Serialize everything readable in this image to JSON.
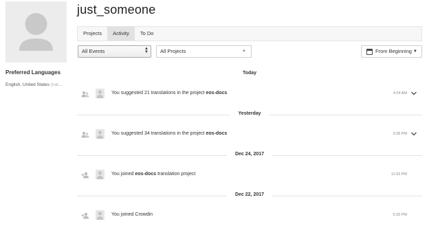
{
  "profile": {
    "username": "just_someone",
    "preferred_languages_label": "Preferred Languages",
    "languages_value": "English, United States",
    "languages_more": "(nat..."
  },
  "tabs": [
    {
      "label": "Projects",
      "active": false
    },
    {
      "label": "Activity",
      "active": true
    },
    {
      "label": "To Do",
      "active": false
    }
  ],
  "filters": {
    "events_selected": "All Events",
    "projects_selected": "All Projects",
    "range_button": "From Beginning"
  },
  "activity": [
    {
      "day": "Today",
      "items": [
        {
          "type_icon": "users-translate-icon",
          "prefix": "You suggested 21 translations in the project ",
          "project": "eos-docs",
          "suffix": "",
          "time": "4:24 AM",
          "expandable": true
        }
      ]
    },
    {
      "day": "Yesterday",
      "items": [
        {
          "type_icon": "users-translate-icon",
          "prefix": "You suggested 34 translations in the project ",
          "project": "eos-docs",
          "suffix": "",
          "time": "3:28 PM",
          "expandable": true
        }
      ]
    },
    {
      "day": "Dec 24, 2017",
      "items": [
        {
          "type_icon": "user-add-icon",
          "prefix": "You joined ",
          "project": "eos-docs",
          "suffix": " translation project",
          "time": "11:53 PM",
          "expandable": false
        }
      ]
    },
    {
      "day": "Dec 22, 2017",
      "items": [
        {
          "type_icon": "user-add-icon",
          "prefix": "You joined Crowdin",
          "project": "",
          "suffix": "",
          "time": "5:33 PM",
          "expandable": false
        }
      ]
    }
  ]
}
